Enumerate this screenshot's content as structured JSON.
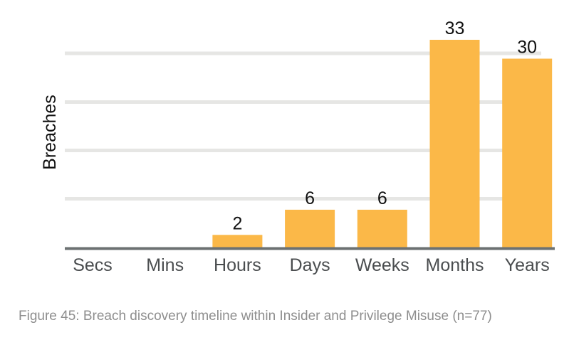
{
  "chart_data": {
    "type": "bar",
    "title": "",
    "xlabel": "",
    "ylabel": "Breaches",
    "categories": [
      "Secs",
      "Mins",
      "Hours",
      "Days",
      "Weeks",
      "Months",
      "Years"
    ],
    "values": [
      0,
      0,
      2,
      6,
      6,
      33,
      30
    ],
    "data_labels": [
      "",
      "",
      "2",
      "6",
      "6",
      "33",
      "30"
    ],
    "ylim": [
      0,
      33
    ],
    "grid": true,
    "legend": "none",
    "bar_color": "#fbb848",
    "grid_color": "#e6e6e4",
    "axis_color": "#6c7172"
  },
  "caption": "Figure 45: Breach discovery timeline within Insider and Privilege Misuse (n=77)"
}
